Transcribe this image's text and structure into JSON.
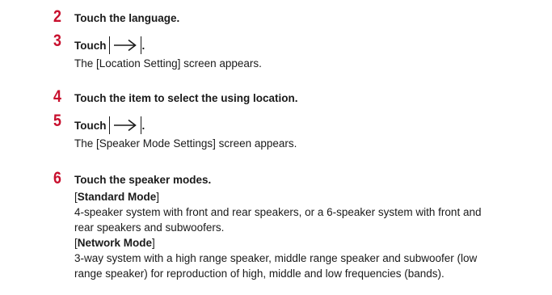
{
  "steps": [
    {
      "number": "2",
      "text": "Touch the language."
    },
    {
      "number": "3",
      "text": "Touch",
      "suffix": ".",
      "note": "The [Location Setting] screen appears."
    },
    {
      "number": "4",
      "text": "Touch the item to select the using location."
    },
    {
      "number": "5",
      "text": "Touch",
      "suffix": ".",
      "note": "The [Speaker Mode Settings] screen appears."
    },
    {
      "number": "6",
      "text": "Touch the speaker modes.",
      "modes": [
        {
          "open": "[",
          "name": "Standard Mode",
          "close": "]",
          "desc1": "4-speaker system with front and rear speakers, or a 6-speaker system with front and",
          "desc2": "rear speakers and subwoofers."
        },
        {
          "open": "[",
          "name": "Network Mode",
          "close": "]",
          "desc1": "3-way system with a high range speaker, middle range speaker and subwoofer (low",
          "desc2": "range speaker) for reproduction of high, middle and low frequencies (bands)."
        }
      ]
    }
  ],
  "icons": {
    "forward": "right-arrow-icon"
  },
  "colors": {
    "step_number": "#c8102e",
    "text": "#1a1a1a"
  }
}
